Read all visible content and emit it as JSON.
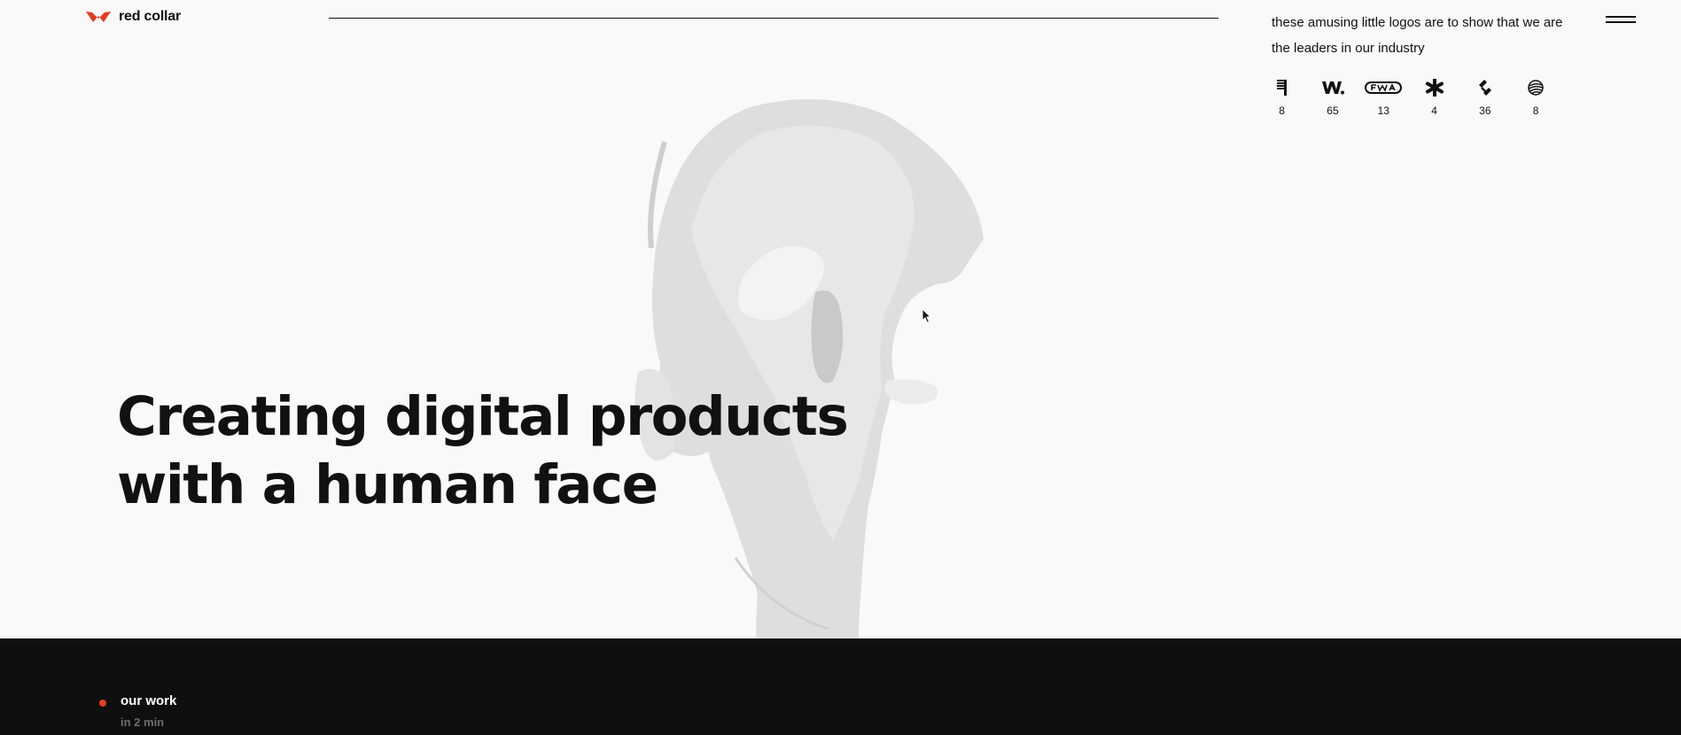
{
  "header": {
    "logo_text": "red collar",
    "brand_color": "#e53b20",
    "menu_icon": "hamburger-menu-icon"
  },
  "awards": {
    "caption": "these amusing little logos are to show that we are the leaders in our industry",
    "items": [
      {
        "icon": "awwwards-bars-icon",
        "count": "8"
      },
      {
        "icon": "w-dot-icon",
        "count": "65"
      },
      {
        "icon": "fwa-icon",
        "count": "13"
      },
      {
        "icon": "asterisk-icon",
        "count": "4"
      },
      {
        "icon": "diamond-arrows-icon",
        "count": "36"
      },
      {
        "icon": "sphere-lines-icon",
        "count": "8"
      }
    ]
  },
  "hero": {
    "title_line1": "Creating digital products",
    "title_line2": "with a human face"
  },
  "work": {
    "label": "our work",
    "time": "in 2 min",
    "dot_color": "#e53b20"
  }
}
